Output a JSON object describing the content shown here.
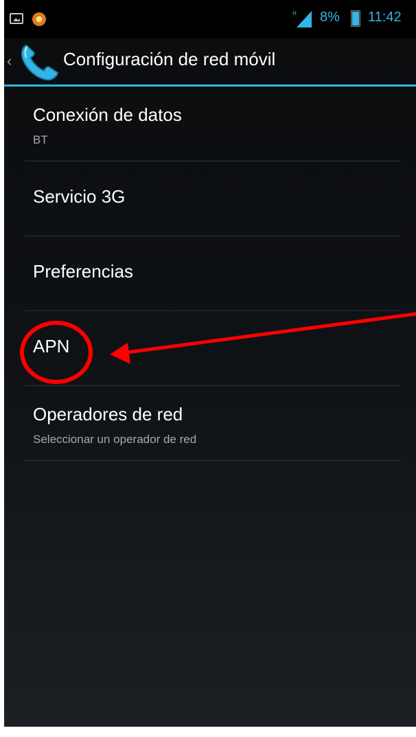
{
  "status_bar": {
    "icons": [
      "gallery-icon",
      "app-notification-icon",
      "signal-icon",
      "battery-icon"
    ],
    "battery_percent": "8%",
    "time": "11:42",
    "accent_color": "#33b5e5"
  },
  "action_bar": {
    "up_symbol": "‹",
    "icon": "phone-icon",
    "title": "Configuración de red móvil"
  },
  "settings": {
    "items": [
      {
        "title": "Conexión de datos",
        "summary": "BT"
      },
      {
        "title": "Servicio 3G"
      },
      {
        "title": "Preferencias"
      },
      {
        "title": "APN"
      },
      {
        "title": "Operadores de red",
        "summary": "Seleccionar un operador de red"
      }
    ]
  },
  "annotation": {
    "highlighted_item": "APN",
    "color": "#ff0000",
    "shapes": [
      "circle",
      "arrow"
    ]
  }
}
